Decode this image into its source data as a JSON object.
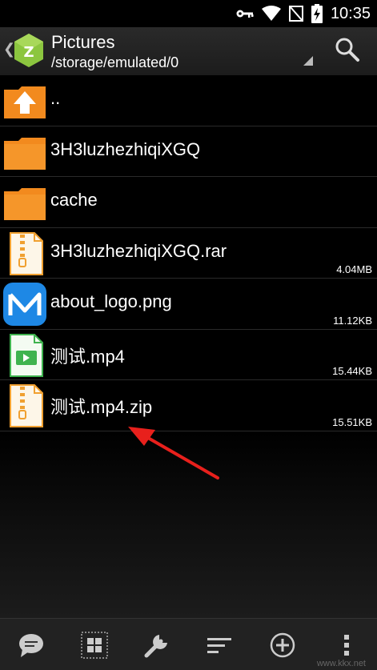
{
  "status_bar": {
    "time": "10:35"
  },
  "header": {
    "title": "Pictures",
    "path": "/storage/emulated/0"
  },
  "files": [
    {
      "name": "..",
      "size": "",
      "icon": "folder-up-icon"
    },
    {
      "name": "3H3luzhezhiqiXGQ",
      "size": "",
      "icon": "folder-icon"
    },
    {
      "name": "cache",
      "size": "",
      "icon": "folder-icon"
    },
    {
      "name": "3H3luzhezhiqiXGQ.rar",
      "size": "4.04MB",
      "icon": "archive-icon"
    },
    {
      "name": "about_logo.png",
      "size": "11.12KB",
      "icon": "image-app-icon"
    },
    {
      "name": "测试.mp4",
      "size": "15.44KB",
      "icon": "video-icon"
    },
    {
      "name": "测试.mp4.zip",
      "size": "15.51KB",
      "icon": "archive-icon"
    }
  ],
  "bottom_bar": {
    "items": [
      "chat-icon",
      "grid-view-icon",
      "tools-icon",
      "sort-icon",
      "add-icon",
      "more-icon"
    ]
  },
  "colors": {
    "folder": "#f28a1e",
    "accent_arrow": "#e8201c",
    "logo_green": "#8cc63f",
    "logo_blue": "#1e88e5"
  },
  "watermark": "www.kkx.net"
}
